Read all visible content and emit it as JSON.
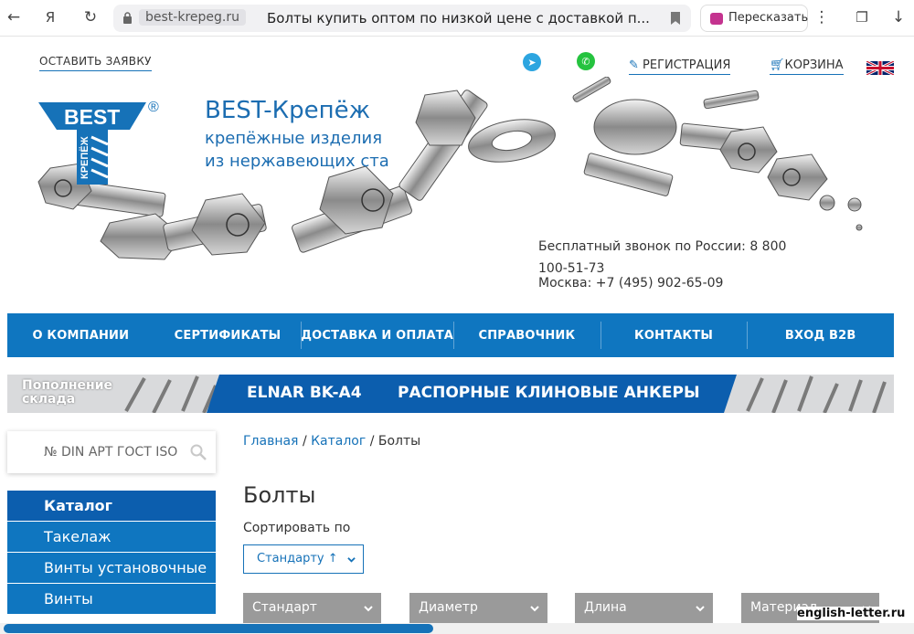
{
  "browser": {
    "domain": "best-krepeg.ru",
    "tab_title": "Болты купить оптом по низкой цене с доставкой п...",
    "retell_label": "Пересказать"
  },
  "header": {
    "leave_request": "ОСТАВИТЬ ЗАЯВКУ",
    "register": "РЕГИСТРАЦИЯ",
    "cart": "КОРЗИНА",
    "logo_text": "BEST",
    "logo_sub": "КРЕПЁЖ",
    "logo_reg": "®",
    "brand": "BEST-Крепёж",
    "tagline1": "крепёжные изделия",
    "tagline2": "из нержавеющих ста",
    "phone_free": "Бесплатный звонок по России: 8 800 100-51-73",
    "phone_msk": "Москва: +7 (495) 902-65-09"
  },
  "nav": [
    "О КОМПАНИИ",
    "СЕРТИФИКАТЫ",
    "ДОСТАВКА И ОПЛАТА",
    "СПРАВОЧНИК",
    "КОНТАКТЫ",
    "ВХОД B2B"
  ],
  "banner": {
    "left_line1": "Пополнение",
    "left_line2": "склада",
    "product": "ELNAR BK-A4",
    "headline": "РАСПОРНЫЕ КЛИНОВЫЕ АНКЕРЫ"
  },
  "search": {
    "placeholder": "№ DIN АРТ ГОСТ ISO"
  },
  "sidebar": [
    "Каталог",
    "Такелаж",
    "Винты установочные",
    "Винты"
  ],
  "breadcrumb": {
    "home": "Главная",
    "sep": "/",
    "catalog": "Каталог",
    "current": "Болты"
  },
  "page_title": "Болты",
  "sort": {
    "label": "Сортировать по",
    "value": "Стандарту",
    "arrow": "↑"
  },
  "filters": [
    "Стандарт",
    "Диаметр",
    "Длина",
    "Материал"
  ],
  "watermark": "english-letter.ru",
  "colors": {
    "primary": "#0f76c0",
    "dark": "#0c5eae",
    "filter": "#9a9a9a"
  }
}
